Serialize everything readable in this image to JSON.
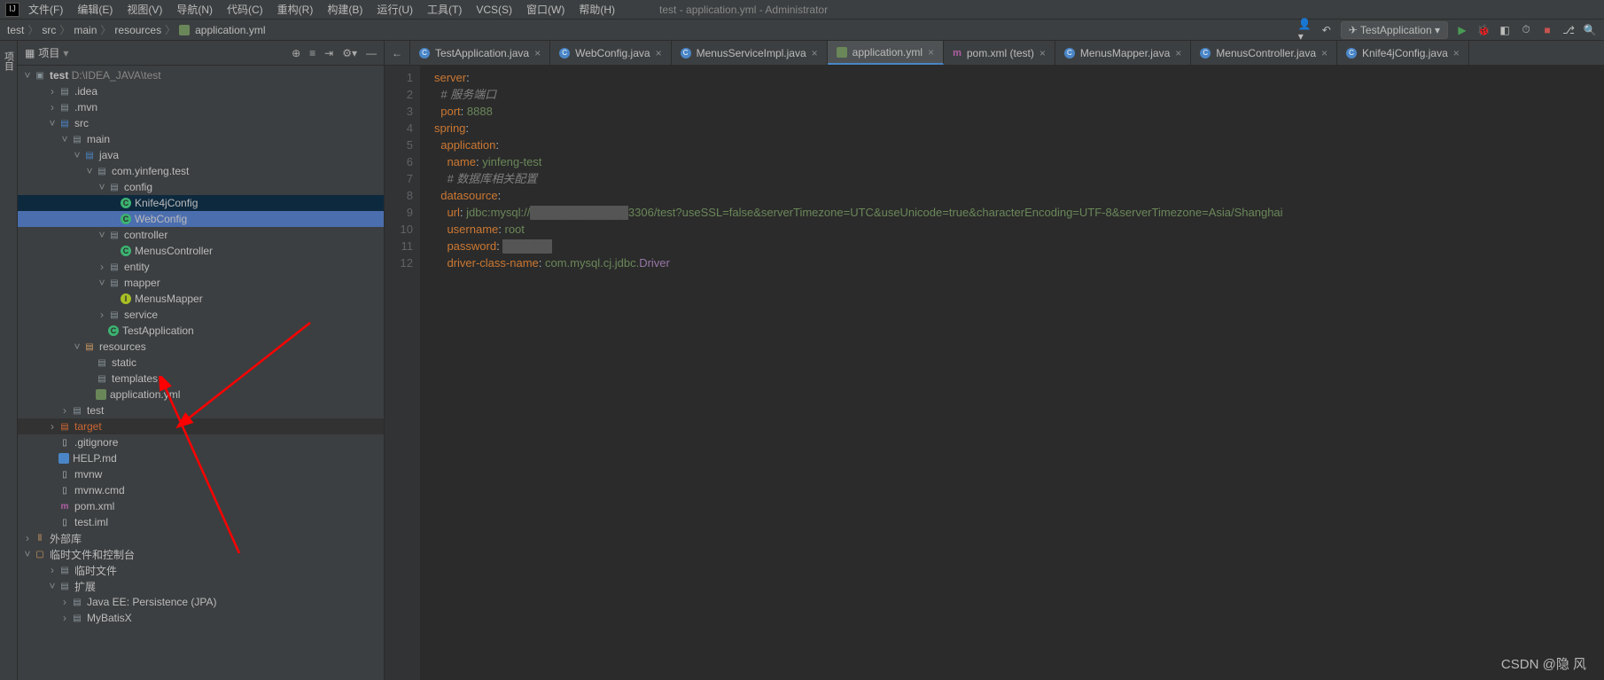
{
  "window_title": "test - application.yml - Administrator",
  "menu": [
    "文件(F)",
    "编辑(E)",
    "视图(V)",
    "导航(N)",
    "代码(C)",
    "重构(R)",
    "构建(B)",
    "运行(U)",
    "工具(T)",
    "VCS(S)",
    "窗口(W)",
    "帮助(H)"
  ],
  "breadcrumbs": [
    "test",
    "src",
    "main",
    "resources",
    "application.yml"
  ],
  "run_config": "TestApplication",
  "panel": {
    "title": "项目",
    "title_icon": "▦"
  },
  "project_path": "D:\\IDEA_JAVA\\test",
  "tree": {
    "root": "test",
    "idea": ".idea",
    "mvn": ".mvn",
    "src": "src",
    "main_folder": "main",
    "java": "java",
    "pkg": "com.yinfeng.test",
    "config": "config",
    "knife": "Knife4jConfig",
    "webconfig": "WebConfig",
    "controller": "controller",
    "menusctrl": "MenusController",
    "entity": "entity",
    "mapper": "mapper",
    "menusmap": "MenusMapper",
    "service": "service",
    "testapp": "TestApplication",
    "resources": "resources",
    "static": "static",
    "templates": "templates",
    "appyml": "application.yml",
    "test_folder": "test",
    "target": "target",
    "gitignore": ".gitignore",
    "help": "HELP.md",
    "mvnw": "mvnw",
    "mvnwcmd": "mvnw.cmd",
    "pom": "pom.xml",
    "testiml": "test.iml",
    "extlib": "外部库",
    "scratch": "临时文件和控制台",
    "scratchfiles": "临时文件",
    "extensions": "扩展",
    "jpa": "Java EE: Persistence (JPA)",
    "mybatis": "MyBatisX"
  },
  "tabs": [
    {
      "label": "TestApplication.java",
      "type": "class"
    },
    {
      "label": "WebConfig.java",
      "type": "class"
    },
    {
      "label": "MenusServiceImpl.java",
      "type": "class"
    },
    {
      "label": "application.yml",
      "type": "yml",
      "active": true
    },
    {
      "label": "pom.xml (test)",
      "type": "xml"
    },
    {
      "label": "MenusMapper.java",
      "type": "class"
    },
    {
      "label": "MenusController.java",
      "type": "class"
    },
    {
      "label": "Knife4jConfig.java",
      "type": "class"
    }
  ],
  "code": {
    "lines": [
      "1",
      "2",
      "3",
      "4",
      "5",
      "6",
      "7",
      "8",
      "9",
      "10",
      "11",
      "12"
    ],
    "l1a": "server",
    "l1b": ":",
    "l2": "# 服务端口",
    "l3a": "port",
    "l3b": ": ",
    "l3c": "8888",
    "l4a": "spring",
    "l4b": ":",
    "l5a": "application",
    "l5b": ":",
    "l6a": "name",
    "l6b": ": ",
    "l6c": "yinfeng-test",
    "l7": "# 数据库相关配置",
    "l8a": "datasource",
    "l8b": ":",
    "l9a": "url",
    "l9b": ": ",
    "l9c": "jdbc:mysql://",
    "l9d": "3306/test?useSSL=false&serverTimezone=UTC&useUnicode=true&characterEncoding=UTF-8&serverTimezone=Asia/Shanghai",
    "l10a": "username",
    "l10b": ": ",
    "l10c": "root",
    "l11a": "password",
    "l11b": ": ",
    "l12a": "driver-class-name",
    "l12b": ": ",
    "l12c": "com.mysql.cj.jdbc.",
    "l12d": "Driver"
  },
  "watermark": "CSDN @隐 风"
}
